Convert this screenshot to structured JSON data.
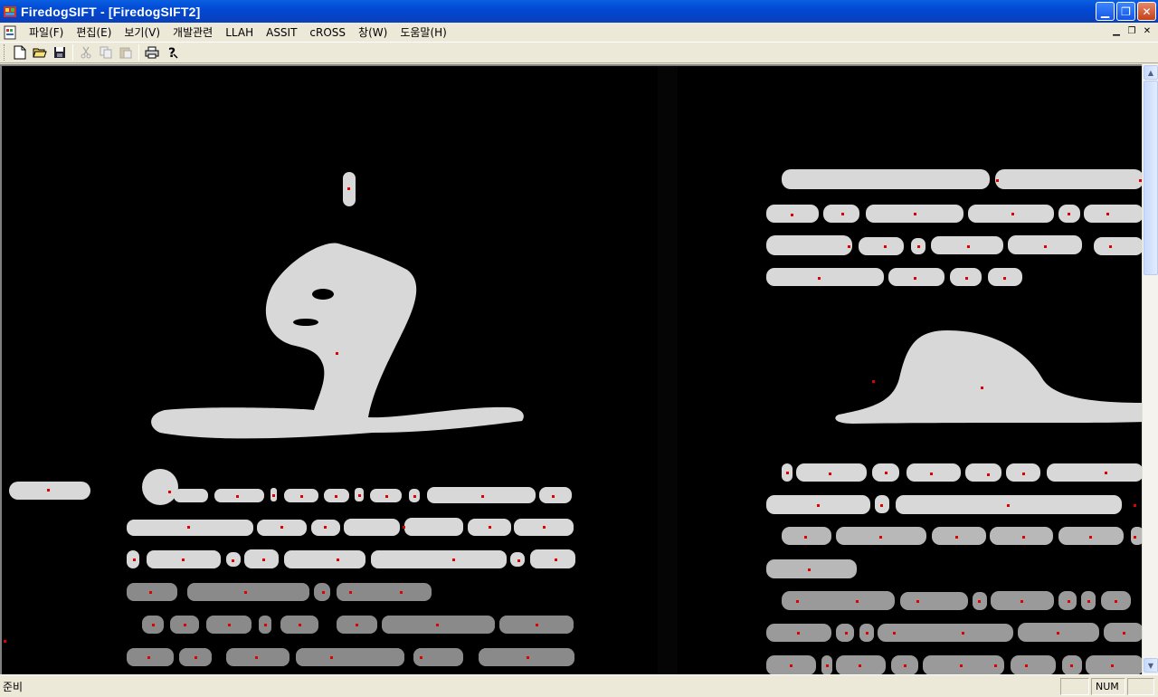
{
  "window": {
    "title": "FiredogSIFT - [FiredogSIFT2]"
  },
  "menu": {
    "items": [
      "파일(F)",
      "편집(E)",
      "보기(V)",
      "개발관련",
      "LLAH",
      "ASSIT",
      "cROSS",
      "창(W)",
      "도움말(H)"
    ]
  },
  "toolbar": {
    "icons": [
      "new-file-icon",
      "open-folder-icon",
      "save-icon",
      "cut-icon",
      "copy-icon",
      "paste-icon",
      "print-icon",
      "help-icon"
    ]
  },
  "status": {
    "text": "준비",
    "num_indicator": "NUM"
  },
  "colors": {
    "blob": "#d8d8d8",
    "blob_dim": "#8a8a8a",
    "keypoint": "#e00000",
    "titlebar": "#0149d6"
  }
}
